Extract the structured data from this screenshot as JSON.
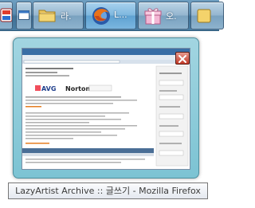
{
  "taskbar": {
    "buttons": [
      {
        "label": "",
        "icon": "security-shield-icon"
      },
      {
        "label": "",
        "icon": "window-icon"
      },
      {
        "label": "라.",
        "icon": "folder-icon"
      },
      {
        "label": "L...",
        "icon": "firefox-icon"
      },
      {
        "label": "오.",
        "icon": "gift-box-icon"
      }
    ]
  },
  "preview": {
    "window_title": "LazyArtist Archive :: 글쓰기 - Mozilla Firefox",
    "thumbnail_logos": {
      "avg": "AVG",
      "norton": "Norton"
    }
  },
  "colors": {
    "taskbar": "#4a7ea3",
    "preview_frame": "#8fcad8",
    "close_button": "#c23a28"
  }
}
